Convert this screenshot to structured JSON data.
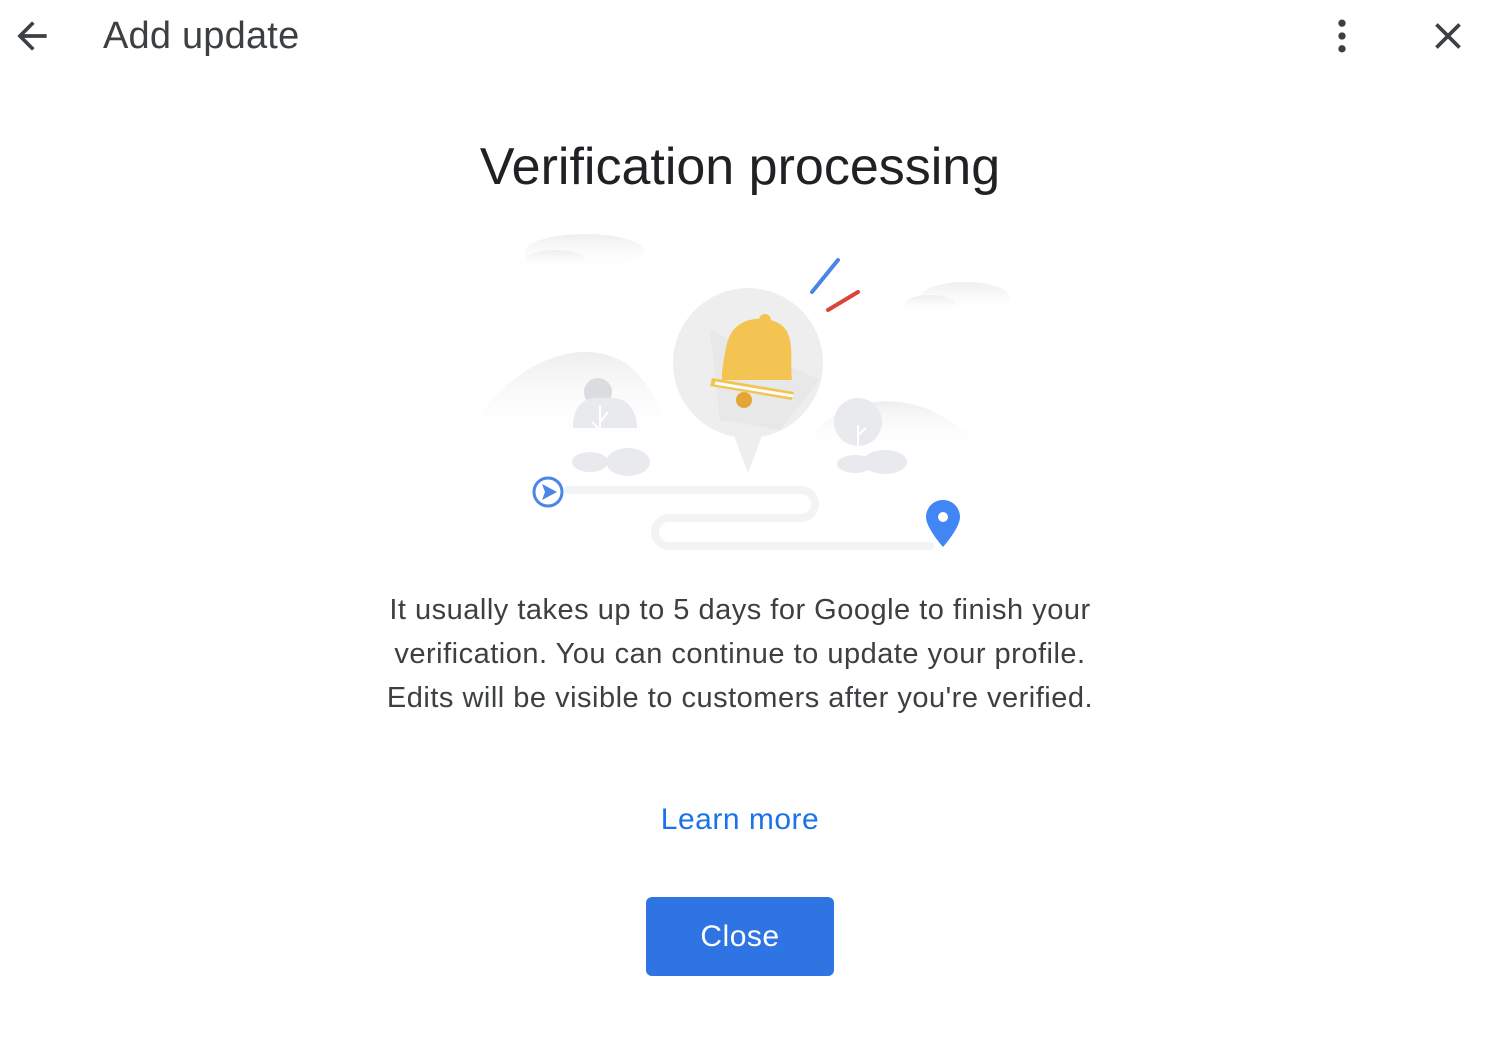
{
  "header": {
    "title": "Add update",
    "back_icon": "arrow-back-icon",
    "more_icon": "more-vert-icon",
    "close_icon": "close-icon"
  },
  "main": {
    "heading": "Verification processing",
    "description": "It usually takes up to 5 days for Google to finish your verification. You can continue to update your profile. Edits will be visible to customers after you're verified.",
    "learn_more": "Learn more",
    "close_button": "Close"
  },
  "illustration": {
    "icons": [
      "bell-icon",
      "location-pin-icon",
      "start-arrow-icon",
      "tree-icon"
    ]
  },
  "colors": {
    "accent": "#1a73e8",
    "button": "#2f74e3",
    "bell": "#f4c453",
    "pin": "#4285f4",
    "red_stroke": "#db4437",
    "blue_stroke": "#4a86e8"
  }
}
